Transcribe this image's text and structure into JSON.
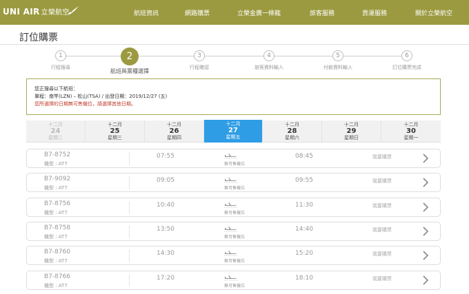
{
  "brand": {
    "name_en": "UNI AIR",
    "name_zh": "立榮航空"
  },
  "nav": [
    "航班資訊",
    "網路購票",
    "立榮金廣一條龍",
    "旅客服務",
    "貨運服務",
    "關於立榮航空"
  ],
  "page_title": "訂位購票",
  "steps": [
    {
      "num": "1",
      "label": "行程搜尋"
    },
    {
      "num": "2",
      "label": "航班與票種選擇"
    },
    {
      "num": "3",
      "label": "行程確認"
    },
    {
      "num": "4",
      "label": "旅客資料輸入"
    },
    {
      "num": "5",
      "label": "付款資料輸入"
    },
    {
      "num": "6",
      "label": "訂位購票完成"
    }
  ],
  "info": {
    "line1": "您正搜尋以下航班：",
    "line2": "單程：南竿(LZN) – 松山(TSA)  /  出發日期：2019/12/27 (五)",
    "warning": "您所選擇的日期無可售機位，請選擇其他日期。"
  },
  "dates": [
    {
      "month": "十二月",
      "day": "24",
      "weekday": "星期二",
      "state": "disabled"
    },
    {
      "month": "十二月",
      "day": "25",
      "weekday": "星期三",
      "state": "normal"
    },
    {
      "month": "十二月",
      "day": "26",
      "weekday": "星期四",
      "state": "normal"
    },
    {
      "month": "十二月",
      "day": "27",
      "weekday": "星期五",
      "state": "selected"
    },
    {
      "month": "十二月",
      "day": "28",
      "weekday": "星期六",
      "state": "normal"
    },
    {
      "month": "十二月",
      "day": "29",
      "weekday": "星期日",
      "state": "normal"
    },
    {
      "month": "十二月",
      "day": "30",
      "weekday": "星期一",
      "state": "normal"
    }
  ],
  "flights": [
    {
      "flight_no": "B7-8752",
      "aircraft": "機型 : AT7",
      "depart": "07:55",
      "status": "無可售機位",
      "arrive": "08:45",
      "buy_label": "我要購票"
    },
    {
      "flight_no": "B7-9092",
      "aircraft": "機型 : AT7",
      "depart": "09:05",
      "status": "無可售機位",
      "arrive": "09:55",
      "buy_label": "我要購票"
    },
    {
      "flight_no": "B7-8756",
      "aircraft": "機型 : AT7",
      "depart": "10:40",
      "status": "無可售機位",
      "arrive": "11:30",
      "buy_label": "我要購票"
    },
    {
      "flight_no": "B7-8758",
      "aircraft": "機型 : AT7",
      "depart": "13:50",
      "status": "無可售機位",
      "arrive": "14:40",
      "buy_label": "我要購票"
    },
    {
      "flight_no": "B7-8760",
      "aircraft": "機型 : AT7",
      "depart": "14:30",
      "status": "無可售機位",
      "arrive": "15:20",
      "buy_label": "我要購票"
    },
    {
      "flight_no": "B7-8766",
      "aircraft": "機型 : AT7",
      "depart": "17:20",
      "status": "無可售機位",
      "arrive": "18:10",
      "buy_label": "我要購票"
    }
  ],
  "colors": {
    "brand": "#9b9a40",
    "selected_date": "#2e9de5",
    "warning": "#c0392b"
  }
}
